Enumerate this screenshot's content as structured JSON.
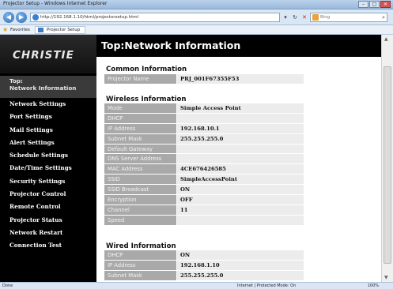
{
  "browser": {
    "window_title": "Projector Setup - Windows Internet Explorer",
    "url": "http://192.168.1.10/html/projectorsetup.html",
    "search_placeholder": "Bing",
    "favorites_label": "Favorites",
    "tab_title": "Projector Setup",
    "status_left": "Done",
    "status_zone": "Internet | Protected Mode: On",
    "zoom": "100%"
  },
  "logo": "CHRISTIE",
  "page_title": "Top:Network Information",
  "sidebar": {
    "active": {
      "line1": "Top:",
      "line2": "Network Information"
    },
    "items": [
      "Network Settings",
      "Port Settings",
      "Mail Settings",
      "Alert Settings",
      "Schedule Settings",
      "Date/Time Settings",
      "Security Settings",
      "Projector Control",
      "Remote Control",
      "Projector Status",
      "Network Restart",
      "Connection Test"
    ]
  },
  "common": {
    "title": "Common Information",
    "rows": [
      {
        "label": "Projector Name",
        "value": "PRJ_001F67355F53"
      }
    ]
  },
  "wireless": {
    "title": "Wireless Information",
    "rows": [
      {
        "label": "Mode",
        "value": "Simple Access Point"
      },
      {
        "label": "DHCP",
        "value": ""
      },
      {
        "label": "IP Address",
        "value": "192.168.10.1"
      },
      {
        "label": "Subnet Mask",
        "value": "255.255.255.0"
      },
      {
        "label": "Default Gateway",
        "value": ""
      },
      {
        "label": "DNS Server Address",
        "value": ""
      },
      {
        "label": "MAC Address",
        "value": "4CE676426585"
      },
      {
        "label": "SSID",
        "value": "SimpleAccessPoint"
      },
      {
        "label": "SSID Broadcast",
        "value": "ON"
      },
      {
        "label": "Encryption",
        "value": "OFF"
      },
      {
        "label": "Channel",
        "value": "11"
      },
      {
        "label": "Speed",
        "value": ""
      }
    ]
  },
  "wired": {
    "title": "Wired Information",
    "rows": [
      {
        "label": "DHCP",
        "value": "ON"
      },
      {
        "label": "IP Address",
        "value": "192.168.1.10"
      },
      {
        "label": "Subnet Mask",
        "value": "255.255.255.0"
      }
    ]
  }
}
